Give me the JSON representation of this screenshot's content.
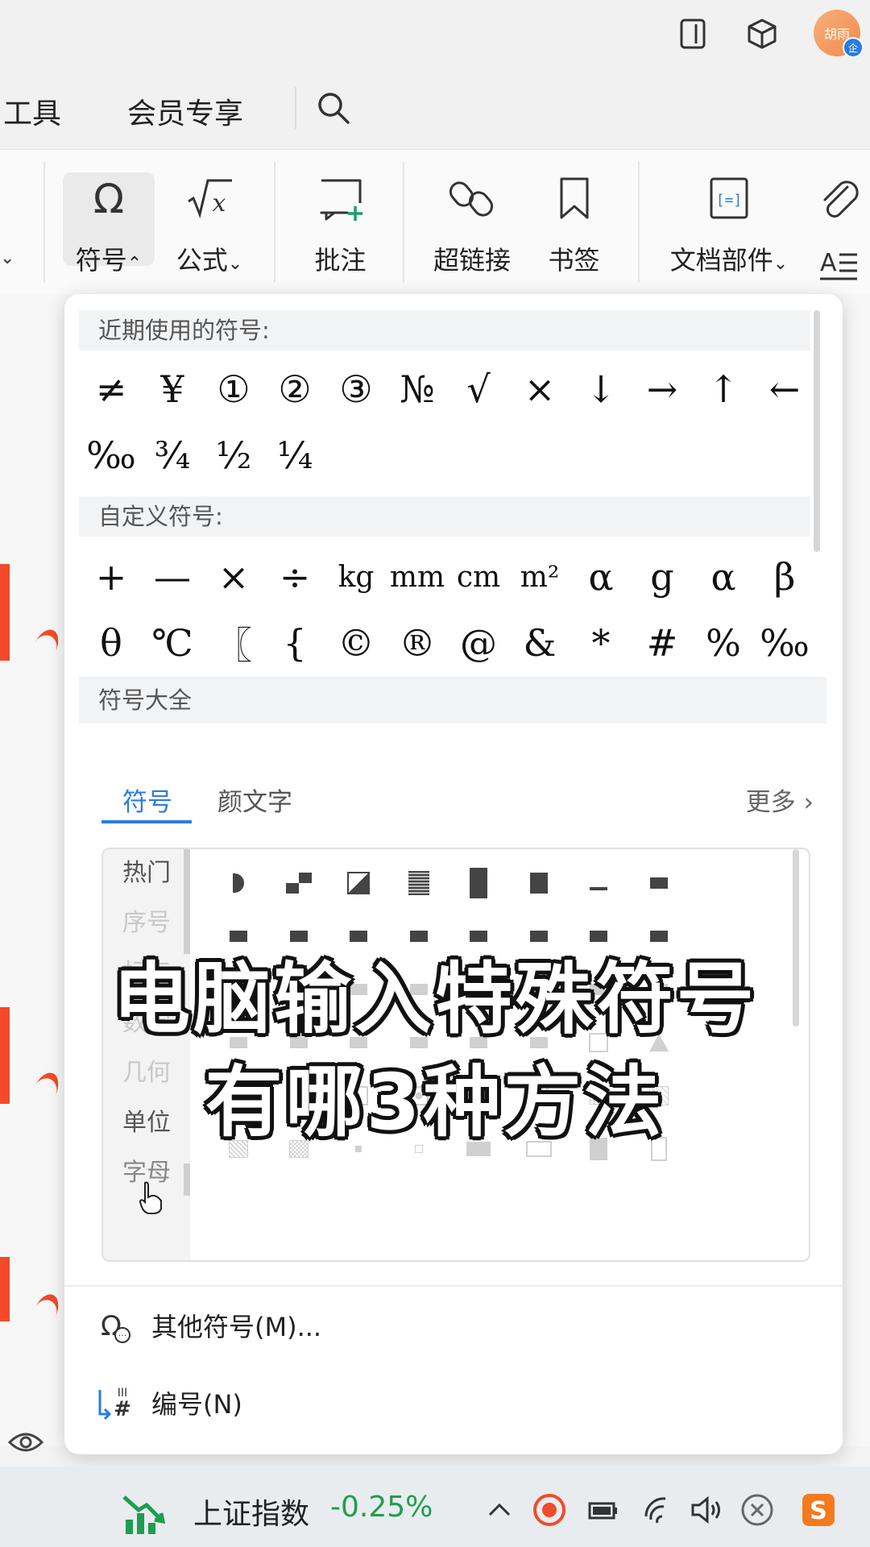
{
  "titlebar": {
    "avatar_text": "胡雨",
    "avatar_badge": "企"
  },
  "menu": {
    "tabs": [
      "工具",
      "会员专享"
    ]
  },
  "ribbon": {
    "buttons": [
      {
        "label": "符号",
        "arrow": "⌃"
      },
      {
        "label": "公式",
        "arrow": "⌄"
      },
      {
        "label": "批注"
      },
      {
        "label": "超链接"
      },
      {
        "label": "书签"
      },
      {
        "label": "文档部件",
        "arrow": "⌄"
      }
    ]
  },
  "panel": {
    "recent_header": "近期使用的符号:",
    "recent_symbols": [
      "≠",
      "¥",
      "①",
      "②",
      "③",
      "№",
      "√",
      "×",
      "↓",
      "→",
      "↑",
      "←",
      "‰",
      "¾",
      "½",
      "¼"
    ],
    "custom_header": "自定义符号:",
    "custom_symbols": [
      "+",
      "—",
      "×",
      "÷",
      "kg",
      "mm",
      "cm",
      "m²",
      "α",
      "g",
      "α",
      "β",
      "θ",
      "℃",
      "〖",
      "{",
      "©",
      "®",
      "@",
      "&",
      "*",
      "#",
      "%",
      "‰"
    ],
    "all_header": "符号大全",
    "tabs": [
      "符号",
      "颜文字"
    ],
    "more": "更多",
    "categories": [
      "热门",
      "序号",
      "标点",
      "数学",
      "几何",
      "单位",
      "字母"
    ],
    "actions": [
      "其他符号(M)...",
      "编号(N)"
    ]
  },
  "caption": {
    "line1": "电脑输入特殊符号",
    "line2": "有哪3种方法"
  },
  "taskbar": {
    "stock_label": "上证指数",
    "stock_value": "-0.25%"
  },
  "colors": {
    "accent": "#2a7be4",
    "stock_up": "#1e9e4e",
    "doc_red": "#f24a2a"
  }
}
